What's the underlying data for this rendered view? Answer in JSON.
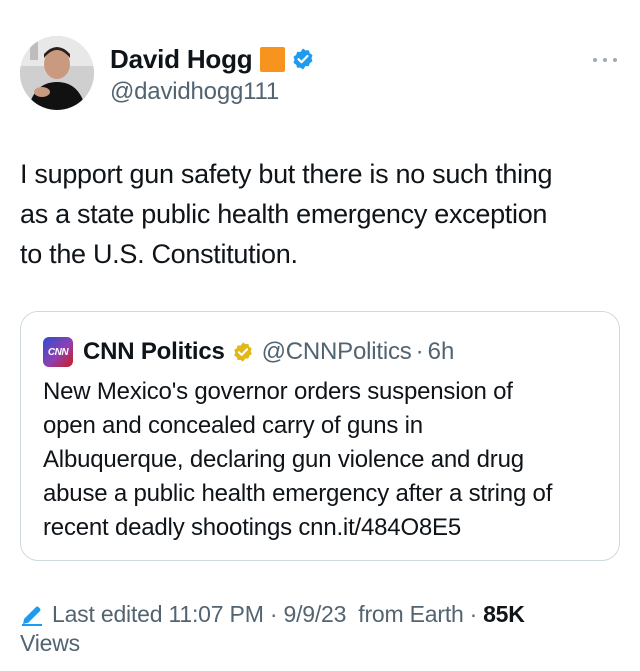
{
  "author": {
    "display_name": "David Hogg",
    "handle": "@davidhogg111",
    "flag_emoji_color": "#f7941d",
    "verified_color": "#1d9bf0"
  },
  "tweet": {
    "text_lines": [
      "I support gun safety but there is no such thing",
      "as a state public health emergency exception",
      "to the U.S. Constitution."
    ]
  },
  "quote": {
    "logo_text": "CNN",
    "name": "CNN Politics",
    "handle": "@CNNPolitics",
    "dot": "·",
    "time": "6h",
    "badge_color": "#e2b719",
    "text_lines": [
      "New Mexico's governor orders suspension of",
      "open and concealed carry of guns in",
      "Albuquerque, declaring gun violence and drug",
      "abuse a public health emergency after a string of",
      "recent deadly shootings cnn.it/484O8E5"
    ]
  },
  "meta": {
    "edited": "Last edited 11:07 PM · 9/9/23",
    "source": "from Earth",
    "dot": "·",
    "views_count": "85K",
    "views_label": "Views",
    "accent": "#1d9bf0"
  },
  "icons": {
    "more": "more-horizontal-icon",
    "verified": "verified-badge-icon",
    "edit": "pencil-icon"
  }
}
